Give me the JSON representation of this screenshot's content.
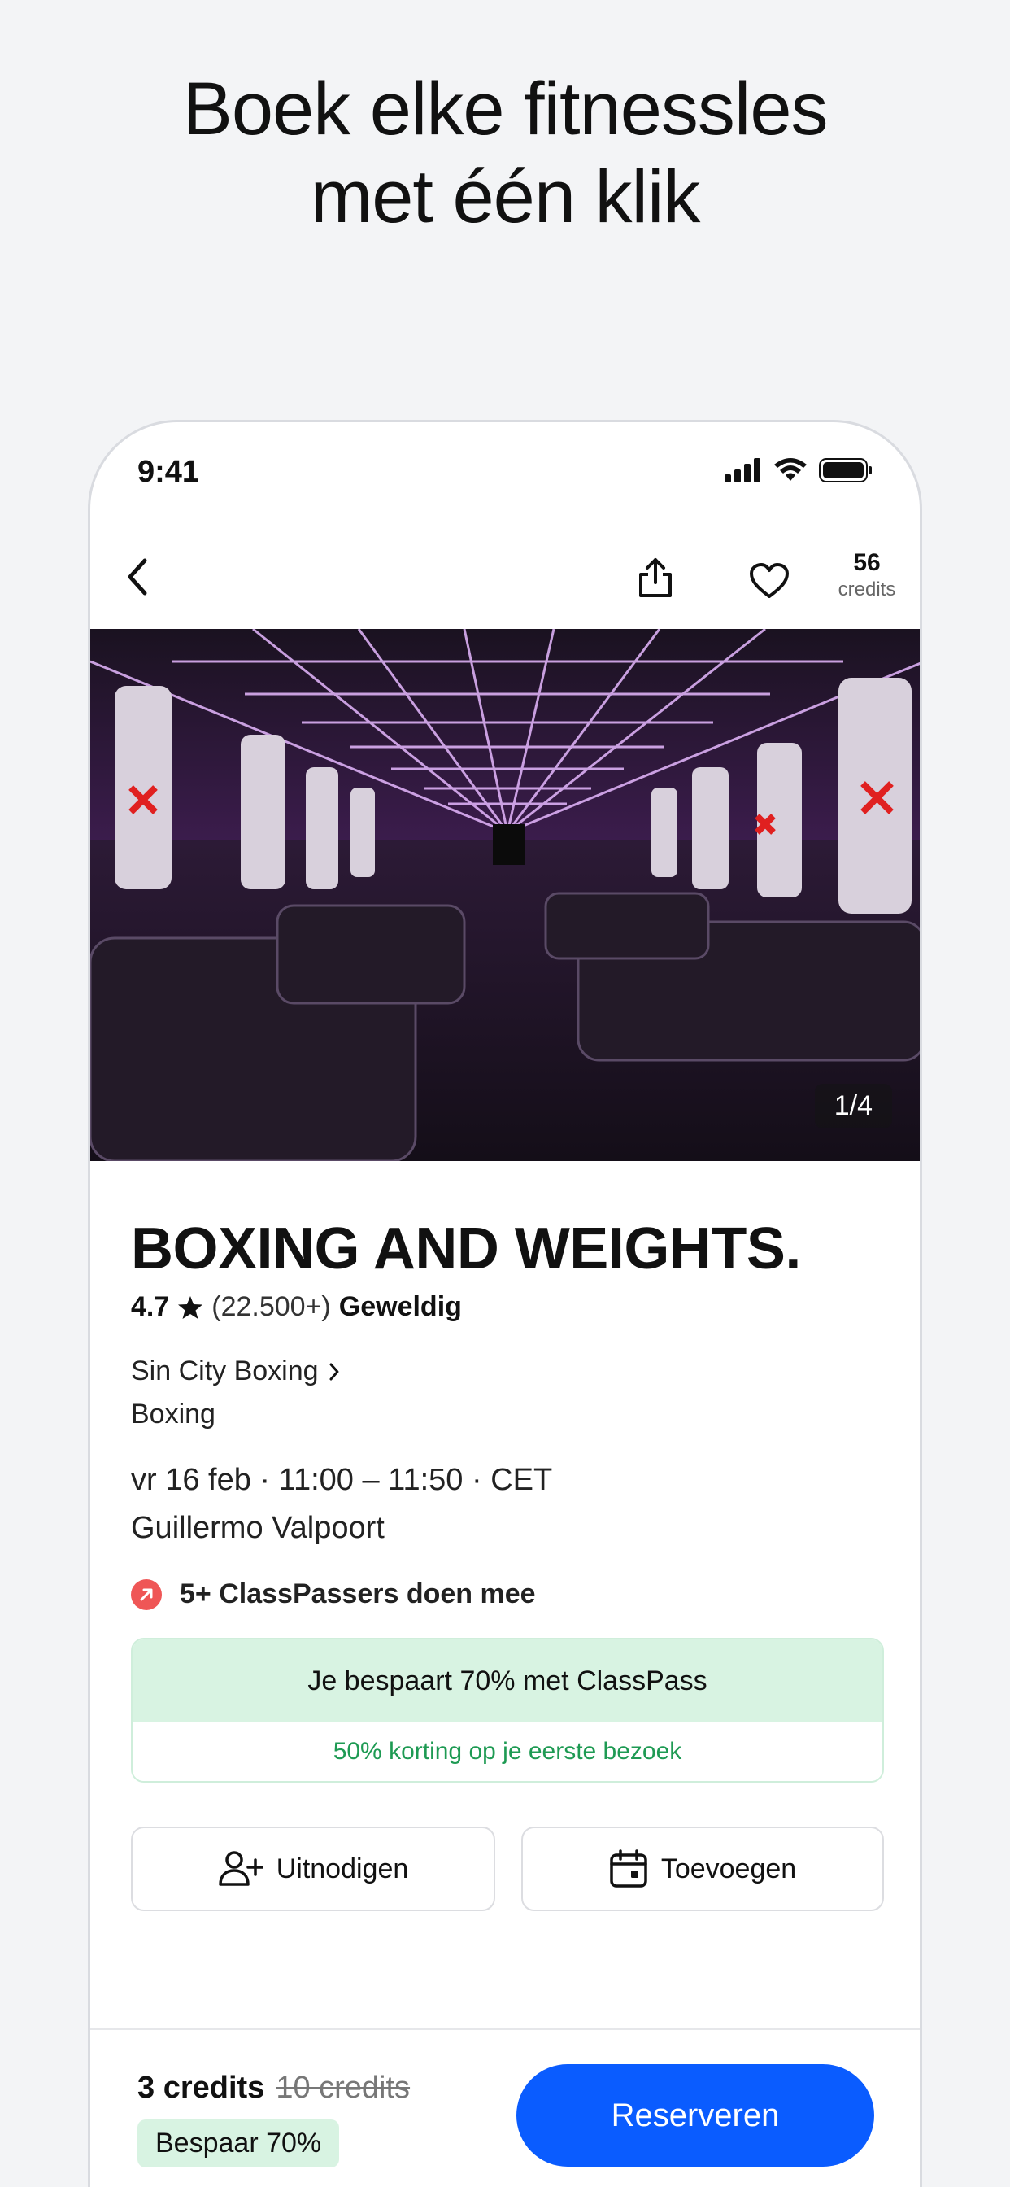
{
  "headline": {
    "line1": "Boek elke fitnessles",
    "line2": "met één klik"
  },
  "status_bar": {
    "time": "9:41"
  },
  "nav": {
    "credits_count": "56",
    "credits_label": "credits"
  },
  "hero": {
    "photo_counter": "1/4"
  },
  "class": {
    "title": "BOXING AND WEIGHTS.",
    "rating": "4.7",
    "rating_count": "(22.500+)",
    "rating_word": "Geweldig",
    "studio": "Sin City Boxing",
    "category": "Boxing",
    "datetime": "vr 16 feb · 11:00 – 11:50 · CET",
    "instructor": "Guillermo Valpoort",
    "social": "5+ ClassPassers doen mee"
  },
  "savings": {
    "headline": "Je bespaart 70% met ClassPass",
    "subline": "50% korting op je eerste bezoek"
  },
  "actions": {
    "invite_label": "Uitnodigen",
    "add_label": "Toevoegen"
  },
  "footer": {
    "price_current": "3 credits",
    "price_old": "10 credits",
    "discount_badge": "Bespaar 70%",
    "reserve_label": "Reserveren"
  },
  "colors": {
    "accent": "#0a5cff",
    "savings_bg": "#d8f3e2",
    "savings_text": "#1e9a53",
    "social_badge": "#ef5656"
  }
}
